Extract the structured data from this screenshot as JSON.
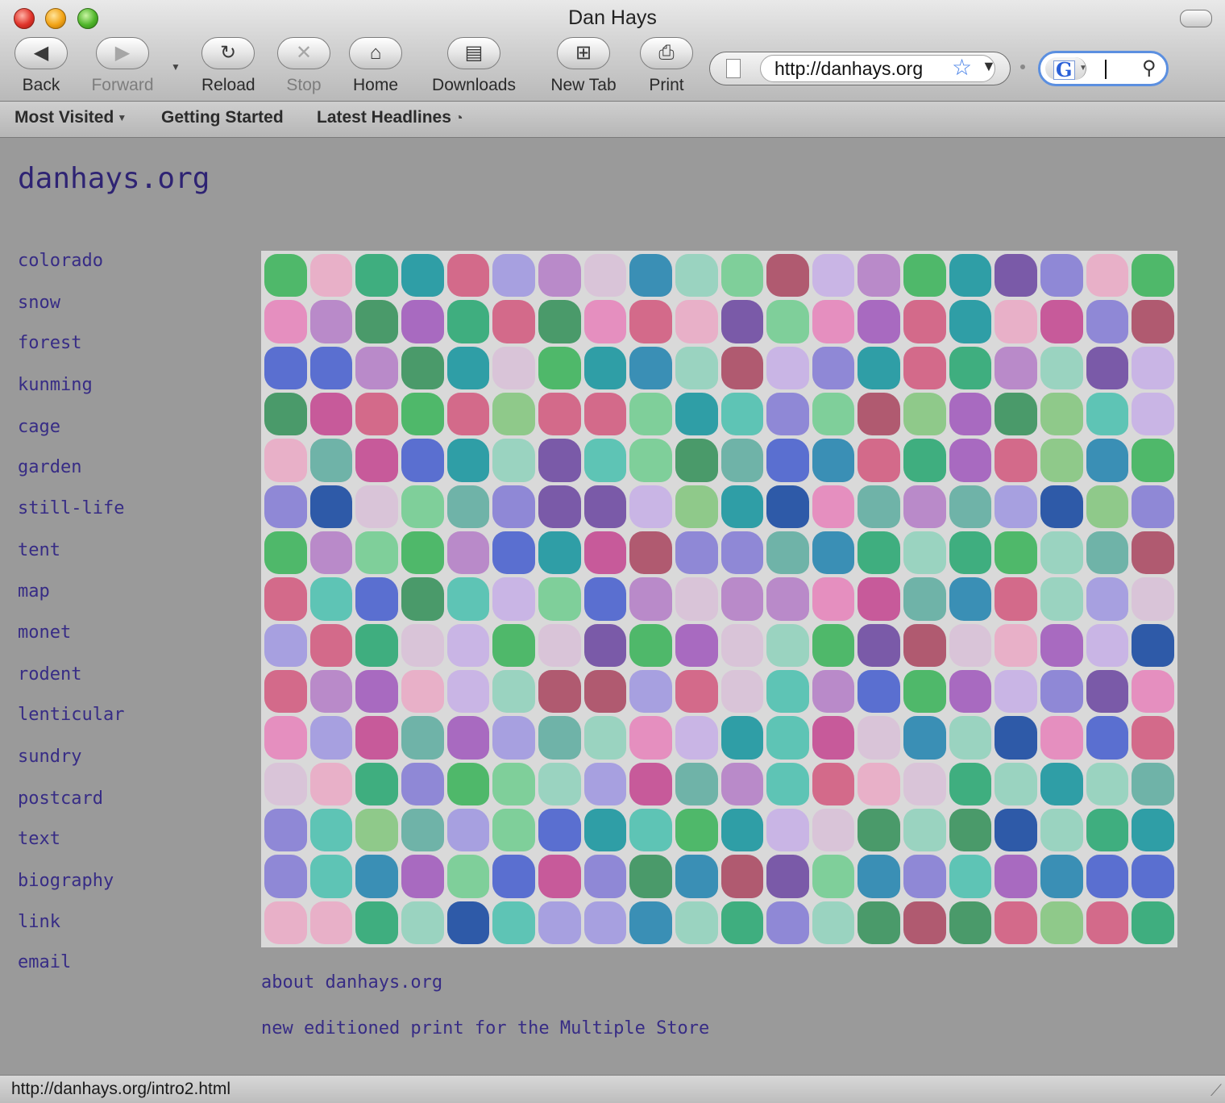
{
  "window": {
    "title": "Dan Hays"
  },
  "toolbar": {
    "back": "Back",
    "forward": "Forward",
    "reload": "Reload",
    "stop": "Stop",
    "home": "Home",
    "downloads": "Downloads",
    "new_tab": "New Tab",
    "print": "Print"
  },
  "icons": {
    "back": "◀",
    "forward": "▶",
    "reload": "↻",
    "stop": "✕",
    "home": "⌂",
    "downloads": "▤",
    "new_tab": "⊞",
    "print": "⎙",
    "star": "☆",
    "search": "⚲"
  },
  "address": {
    "url": "http://danhays.org"
  },
  "search": {
    "engine_letter": "G"
  },
  "bookmarks": {
    "most_visited": "Most Visited",
    "getting_started": "Getting Started",
    "latest_headlines": "Latest Headlines"
  },
  "page": {
    "site_title": "danhays.org",
    "nav": [
      "colorado",
      "snow",
      "forest",
      "kunming",
      "cage",
      "garden",
      "still-life",
      "tent",
      "map",
      "monet",
      "rodent",
      "lenticular",
      "sundry",
      "postcard",
      "text",
      "biography",
      "link",
      "email"
    ],
    "about_link": "about danhays.org",
    "print_link": "new editioned print for the Multiple Store"
  },
  "colors": {
    "link": "#372c85",
    "title": "#2e2373",
    "page_bg": "#9a9a9a",
    "palette": [
      "#6fb3a8",
      "#b98ac9",
      "#3fae7f",
      "#8f88d6",
      "#e58fbf",
      "#2f9ea6",
      "#7fcf9a",
      "#c75a9a",
      "#5a6fd0",
      "#9ad3c0",
      "#d36a8a",
      "#4fb86a",
      "#a7a0e0",
      "#e8b0c8",
      "#3a8fb5",
      "#c9b5e5",
      "#7a5aa8",
      "#5ec4b5",
      "#b05a70",
      "#2e5aa8",
      "#8fc98a",
      "#d9c4d8",
      "#4a9a6a",
      "#a86ac0"
    ]
  },
  "status": {
    "text": "http://danhays.org/intro2.html"
  }
}
